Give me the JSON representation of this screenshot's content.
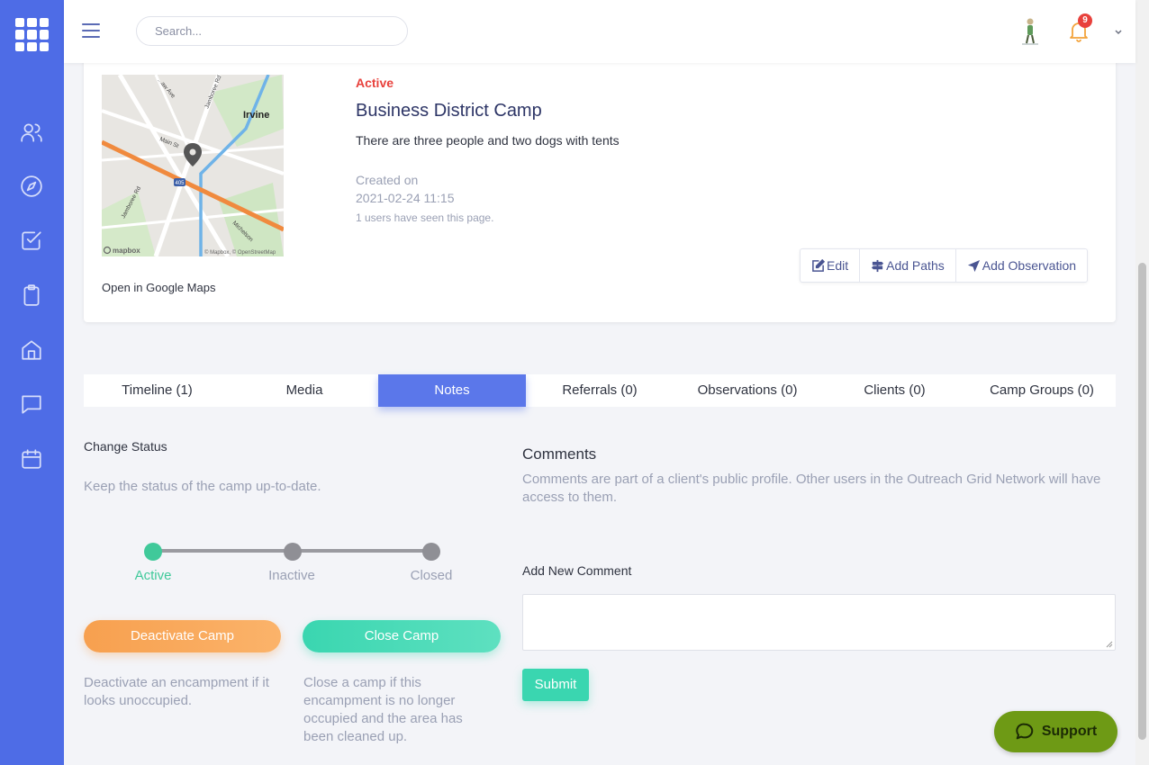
{
  "header": {
    "search_placeholder": "Search...",
    "notification_count": "9"
  },
  "camp": {
    "status": "Active",
    "title": "Business District Camp",
    "description": "There are three people and two dogs with tents",
    "created_label": "Created on",
    "created_date": "2021-02-24 11:15",
    "seen_text": "1 users have seen this page.",
    "map_link": "Open in Google Maps",
    "map_labels": {
      "city": "Irvine",
      "street_ave": "...aw Ave",
      "street_jamboree_top": "Jamboree Rd",
      "street_main": "Main St",
      "street_jamboree_bottom": "Jamboree Rd",
      "street_michelson": "Michelson",
      "highway": "405",
      "logo": "mapbox",
      "attribution": "© Mapbox, © OpenStreetMap"
    },
    "actions": {
      "edit": "Edit",
      "add_paths": "Add Paths",
      "add_observation": "Add Observation"
    }
  },
  "tabs": [
    {
      "label": "Timeline (1)",
      "active": false
    },
    {
      "label": "Media",
      "active": false
    },
    {
      "label": "Notes",
      "active": true
    },
    {
      "label": "Referrals (0)",
      "active": false
    },
    {
      "label": "Observations (0)",
      "active": false
    },
    {
      "label": "Clients (0)",
      "active": false
    },
    {
      "label": "Camp Groups (0)",
      "active": false
    }
  ],
  "change_status": {
    "title": "Change Status",
    "subtitle": "Keep the status of the camp up-to-date.",
    "steps": [
      "Active",
      "Inactive",
      "Closed"
    ],
    "current_step": "Active",
    "deactivate_label": "Deactivate Camp",
    "close_label": "Close Camp",
    "deactivate_help": "Deactivate an encampment if it looks unoccupied.",
    "close_help": "Close a camp if this encampment is no longer occupied and the area has been cleaned up."
  },
  "comments": {
    "title": "Comments",
    "subtitle": "Comments are part of a client's public profile. Other users in the Outreach Grid Network will have access to them.",
    "add_label": "Add New Comment",
    "value": "",
    "submit_label": "Submit"
  },
  "support": {
    "label": "Support"
  },
  "colors": {
    "sidebar": "#4e6ce6",
    "active_tab": "#5b77ea",
    "active_status": "#e8413c",
    "step_active": "#40c99a",
    "deactivate": "#f7a04f",
    "close": "#3ad6b0",
    "support": "#6e9a15"
  }
}
